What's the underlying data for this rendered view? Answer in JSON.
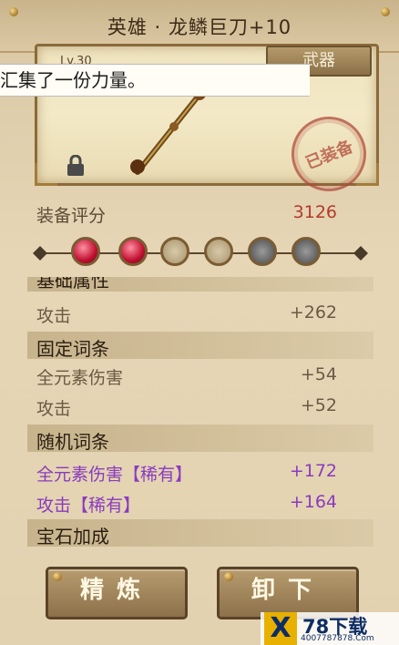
{
  "title": "英雄 · 龙鳞巨刀+10",
  "weapon_tag": "武器",
  "level_badge": "Lv.30",
  "notice": "汇集了一份力量。",
  "equipped_stamp": "已装备",
  "score": {
    "label": "装备评分",
    "value": "3126",
    "color": "#b33a2a"
  },
  "partial_section": "基础属性",
  "base_stats": [
    {
      "label": "攻击",
      "value": "+262"
    }
  ],
  "fixed_section": "固定词条",
  "fixed_stats": [
    {
      "label": "全元素伤害",
      "value": "+54"
    },
    {
      "label": "攻击",
      "value": "+52"
    }
  ],
  "random_section": "随机词条",
  "random_stats": [
    {
      "label": "全元素伤害【稀有】",
      "value": "+172"
    },
    {
      "label": "攻击【稀有】",
      "value": "+164"
    }
  ],
  "gem_section": "宝石加成",
  "gems": [
    "red-gem",
    "red-gem",
    "empty-socket",
    "empty-socket",
    "locked-socket",
    "locked-socket"
  ],
  "buttons": {
    "refine": "精炼",
    "unequip": "卸下"
  },
  "watermark": {
    "logo": "X",
    "name": "78下载",
    "url": "4007787878.Com"
  },
  "colors": {
    "normal_text": "#6b5a44",
    "rare_text": "#8a3bbf",
    "score_value": "#b33a2a"
  }
}
